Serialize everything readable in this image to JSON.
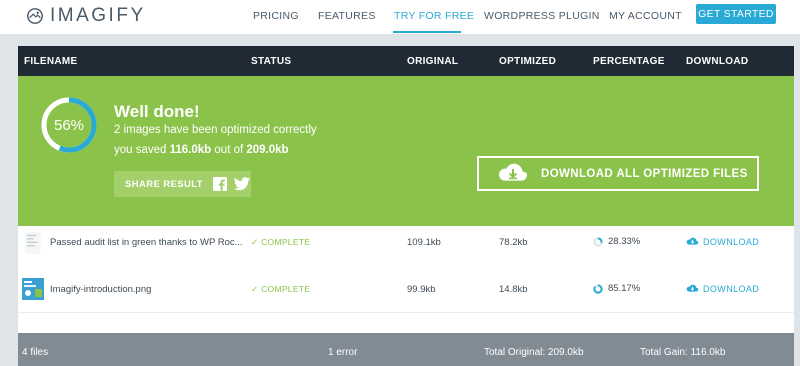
{
  "nav": {
    "logo_text": "IMAGIFY",
    "links": [
      "PRICING",
      "FEATURES",
      "TRY FOR FREE",
      "WORDPRESS PLUGIN",
      "MY ACCOUNT"
    ],
    "active_link": "TRY FOR FREE",
    "cta": "GET STARTED"
  },
  "colors": {
    "accent": "#28a9d6",
    "success": "#8bc34a",
    "header_dark": "#1f2a35",
    "footer_gray": "#808b94"
  },
  "table": {
    "headers": [
      "FILENAME",
      "STATUS",
      "ORIGINAL",
      "OPTIMIZED",
      "PERCENTAGE",
      "DOWNLOAD"
    ],
    "rows": [
      {
        "filename": "Passed audit list in green thanks to WP Roc...",
        "status": "COMPLETE",
        "original": "109.1kb",
        "optimized": "78.2kb",
        "percentage": "28.33%",
        "percentage_value": 0.2833,
        "download": "DOWNLOAD"
      },
      {
        "filename": "Imagify-introduction.png",
        "status": "COMPLETE",
        "original": "99.9kb",
        "optimized": "14.8kb",
        "percentage": "85.17%",
        "percentage_value": 0.8517,
        "download": "DOWNLOAD"
      }
    ],
    "footer": {
      "files": "4 files",
      "errors": "1 error",
      "total_original": "Total Original: 209.0kb",
      "total_gain": "Total Gain: 116.0kb"
    }
  },
  "banner": {
    "progress_label": "56%",
    "progress_value": 0.56,
    "title": "Well done!",
    "line1": "2 images have been optimized correctly",
    "line2_prefix": "you saved ",
    "saved": "116.0kb",
    "line2_mid": " out of ",
    "total": "209.0kb",
    "share_label": "SHARE RESULT",
    "download_all": "DOWNLOAD ALL OPTIMIZED FILES"
  },
  "icons": [
    "imagify-logo-icon",
    "facebook-icon",
    "twitter-icon",
    "cloud-download-icon",
    "check-icon",
    "progress-ring-icon",
    "image-thumbnail"
  ]
}
